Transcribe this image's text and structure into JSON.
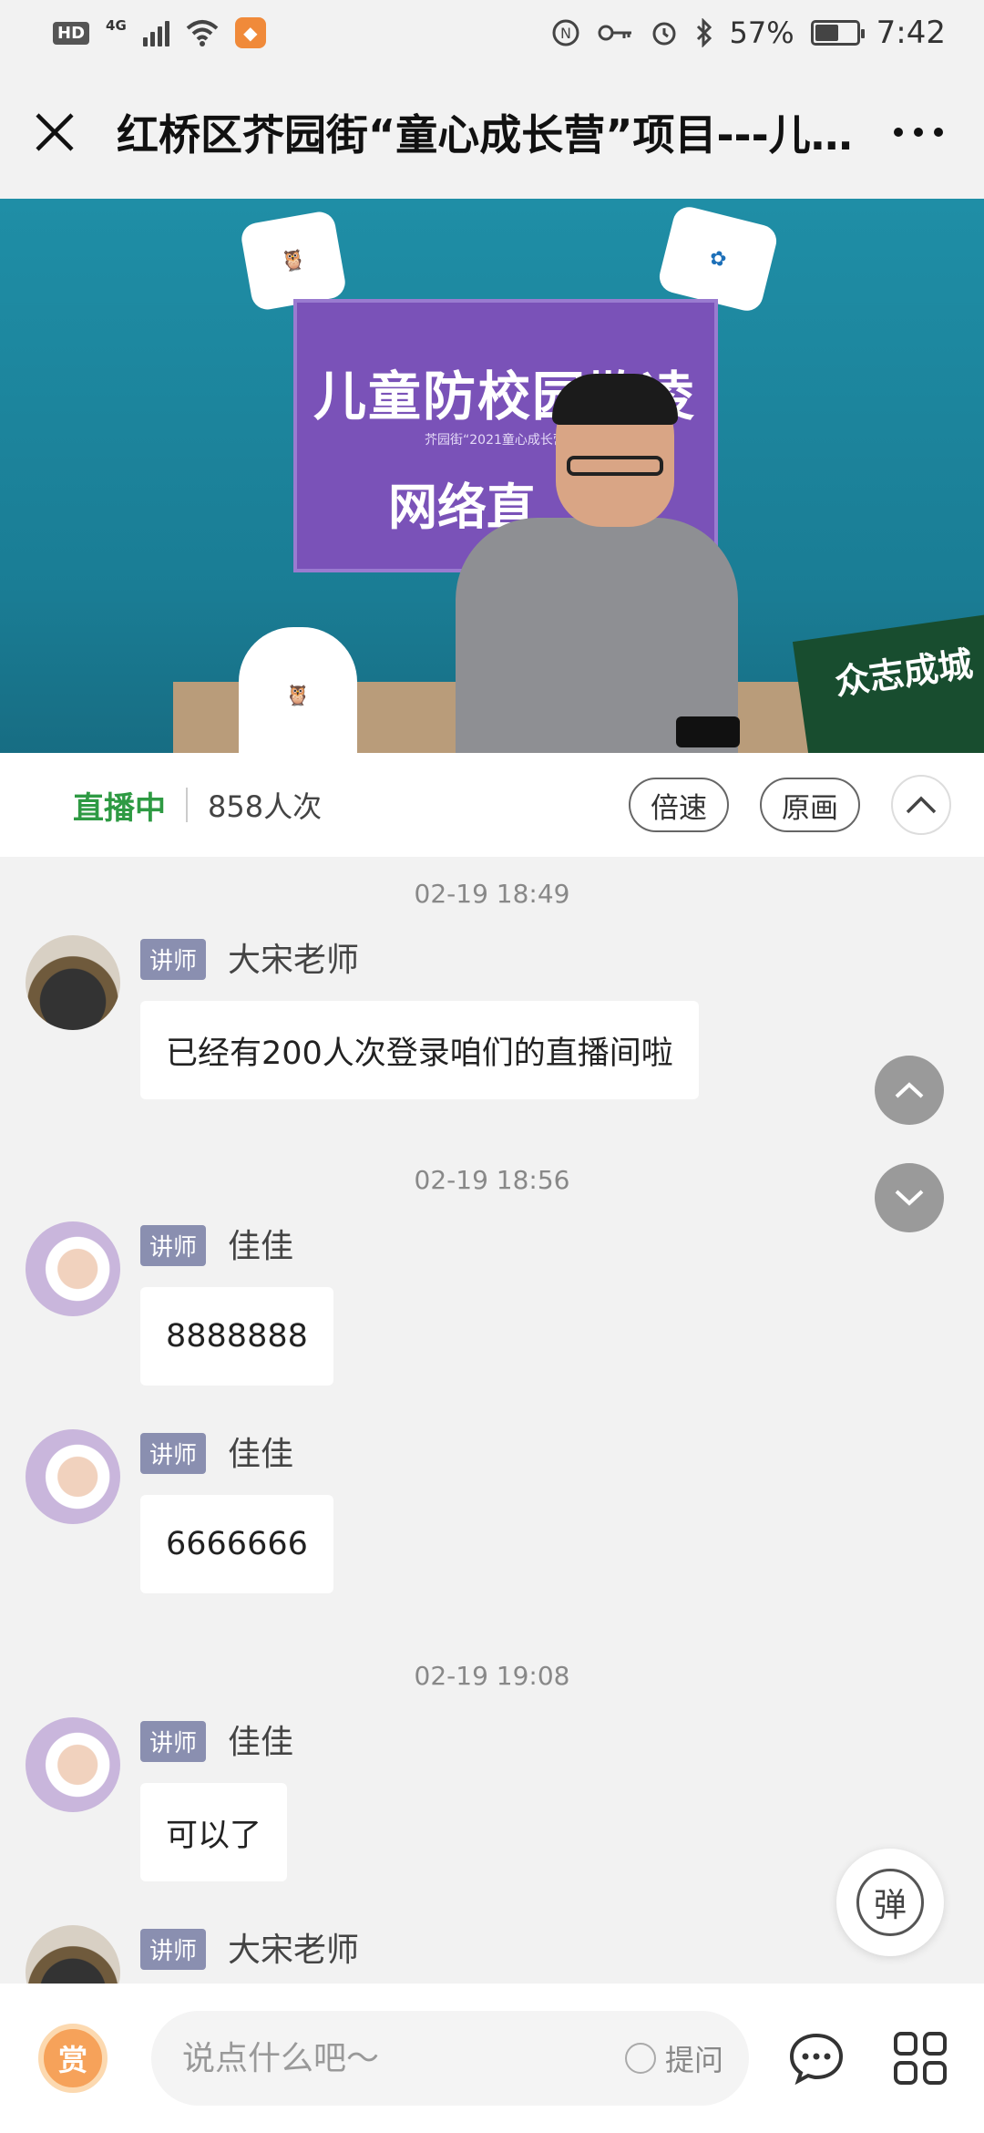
{
  "status_bar": {
    "hd": "HD",
    "network": "4G",
    "battery_percent": "57%",
    "time": "7:42"
  },
  "header": {
    "title": "红桥区芥园街“童心成长营”项目---儿…",
    "close_icon": "close-icon",
    "more_icon": "more-dots-icon"
  },
  "video": {
    "poster_title": "儿童防校园欺凌",
    "poster_subtitle": "芥园街“2021童心成长营”",
    "poster_big": "网络直",
    "sticker_right": "众志成城"
  },
  "live": {
    "status": "直播中",
    "viewers": "858人次",
    "speed_label": "倍速",
    "quality_label": "原画"
  },
  "messages": [
    {
      "timestamp": "02-19 18:49",
      "role": "讲师",
      "name": "大宋老师",
      "text": "已经有200人次登录咱们的直播间啦",
      "avatar": "teacher"
    },
    {
      "timestamp": "02-19 18:56",
      "role": "讲师",
      "name": "佳佳",
      "text": "8888888",
      "avatar": "baby"
    },
    {
      "timestamp": "",
      "role": "讲师",
      "name": "佳佳",
      "text": "6666666",
      "avatar": "baby"
    },
    {
      "timestamp": "02-19 19:08",
      "role": "讲师",
      "name": "佳佳",
      "text": "可以了",
      "avatar": "baby"
    },
    {
      "timestamp": "",
      "role": "讲师",
      "name": "大宋老师",
      "text": "",
      "avatar": "teacher"
    }
  ],
  "controls": {
    "danmu_label": "弹"
  },
  "bottom": {
    "reward_label": "赏",
    "input_placeholder": "说点什么吧～",
    "ask_label": "提问"
  },
  "colors": {
    "live_green": "#2e9a43",
    "role_badge": "#8a8fb0",
    "reward_orange": "#f6a25a"
  }
}
